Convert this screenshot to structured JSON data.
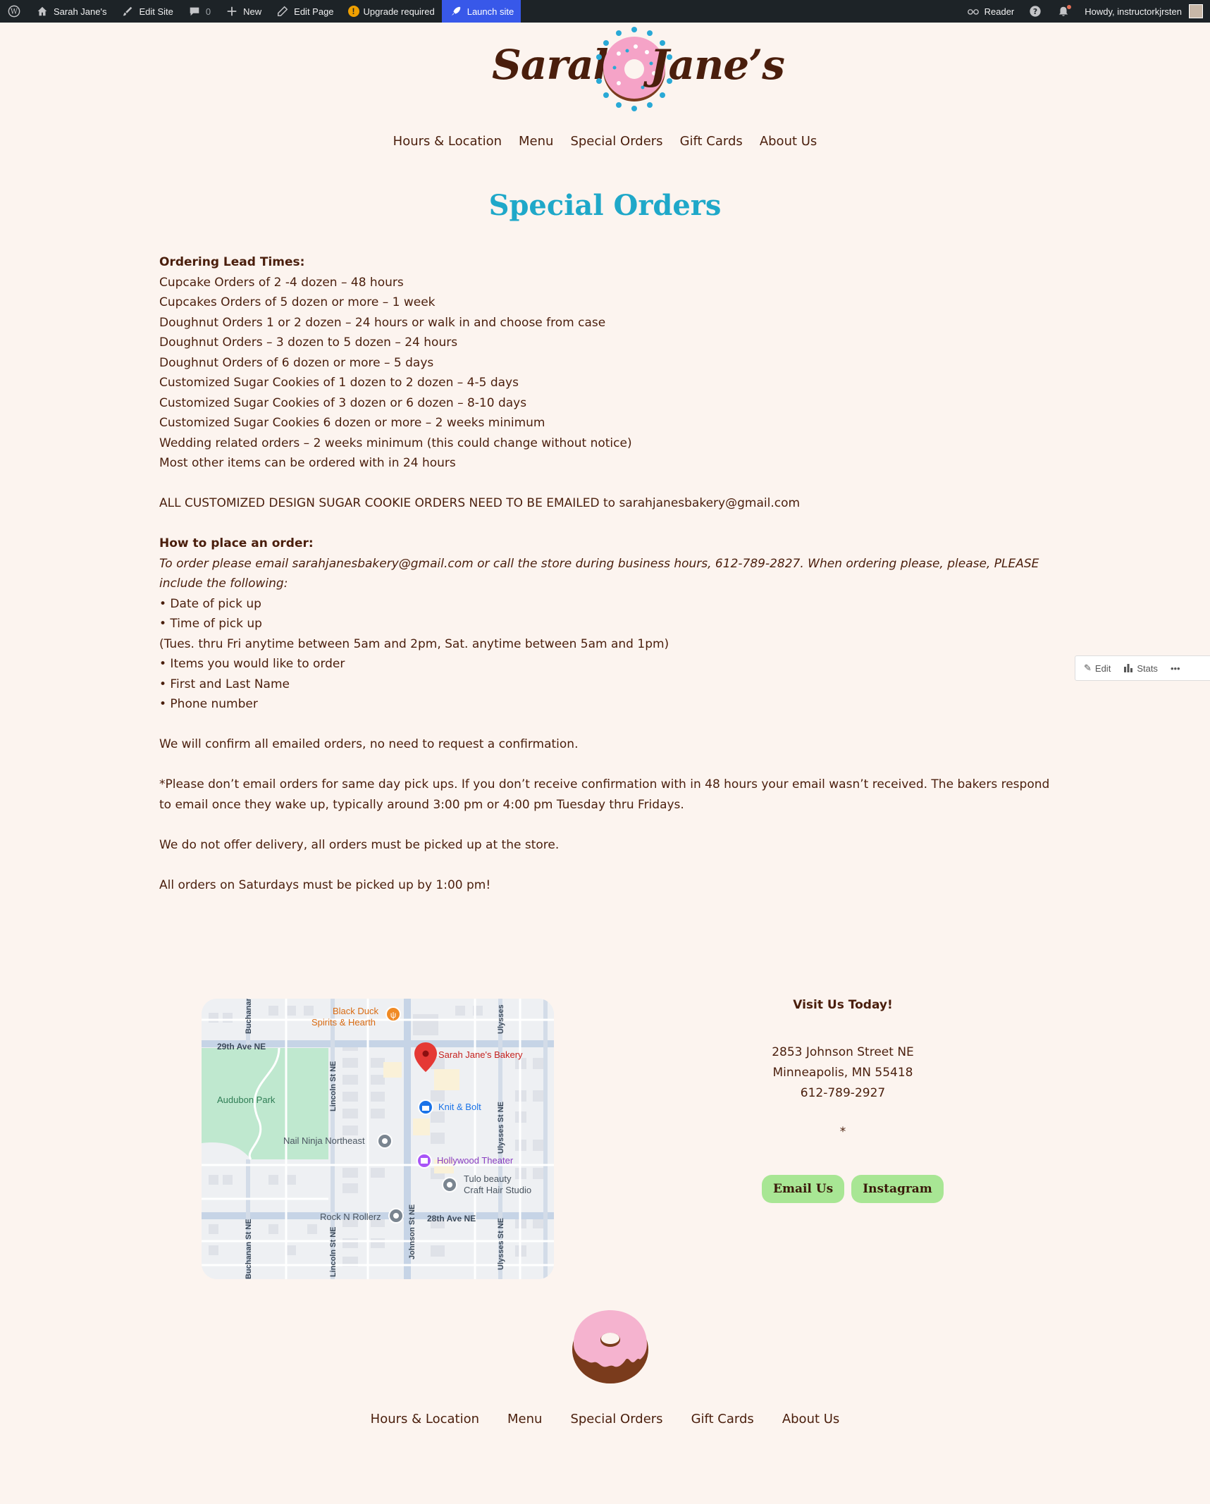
{
  "adminbar": {
    "site_name": "Sarah Jane's",
    "edit_site": "Edit Site",
    "comments_count": "0",
    "new_label": "New",
    "edit_page": "Edit Page",
    "upgrade": "Upgrade required",
    "launch": "Launch site",
    "reader": "Reader",
    "howdy": "Howdy, instructorkjrsten"
  },
  "header": {
    "logo_left": "Sarah",
    "logo_right": "Jane’s",
    "nav": [
      "Hours & Location",
      "Menu",
      "Special Orders",
      "Gift Cards",
      "About Us"
    ]
  },
  "page": {
    "title": "Special Orders",
    "lead_heading": "Ordering Lead Times:",
    "lead_times": [
      "Cupcake Orders of 2 -4 dozen – 48 hours",
      "Cupcakes Orders of 5 dozen or more – 1 week",
      "Doughnut Orders 1 or 2 dozen – 24 hours or walk in and choose from case",
      "Doughnut Orders – 3 dozen to 5 dozen – 24 hours",
      "Doughnut Orders of 6 dozen or more – 5 days",
      "Customized Sugar Cookies of 1 dozen to 2 dozen – 4-5 days",
      "Customized Sugar Cookies of 3 dozen or 6 dozen – 8-10 days",
      "Customized Sugar Cookies 6 dozen or more – 2 weeks minimum",
      "Wedding related orders – 2 weeks minimum (this could change without notice)",
      "Most other items can be ordered with in 24 hours"
    ],
    "custom_notice": "ALL CUSTOMIZED DESIGN SUGAR COOKIE ORDERS NEED TO BE EMAILED to sarahjanesbakery@gmail.com",
    "how_heading": "How to place an order:",
    "how_intro": "To order please email sarahjanesbakery@gmail.com or call the store during business hours, 612-789-2827. When ordering please, please, PLEASE include the following:",
    "bullet_1": "• Date of pick up",
    "bullet_2": "• Time of pick up",
    "hours_note": "(Tues. thru Fri anytime between 5am and 2pm, Sat. anytime between 5am and 1pm)",
    "bullet_3": "• Items you would like to order",
    "bullet_4": "• First and Last Name",
    "bullet_5": "• Phone number",
    "confirm": "We will confirm all emailed orders, no need to request a confirmation.",
    "same_day": "*Please don’t email orders for same day pick ups. If you don’t receive confirmation with in 48 hours your email wasn’t received. The bakers respond to email once they wake up, typically around 3:00 pm or 4:00 pm Tuesday thru Fridays.",
    "delivery": "We do not offer delivery, all orders must be picked up at the store.",
    "saturday": "All orders on Saturdays must be picked up by 1:00 pm!"
  },
  "floatbar": {
    "edit": "Edit",
    "stats": "Stats",
    "more": "•••"
  },
  "map": {
    "labels": {
      "black_duck_1": "Black Duck",
      "black_duck_2": "Spirits & Hearth",
      "ave29": "29th Ave NE",
      "bakery": "Sarah Jane's Bakery",
      "audubon": "Audubon Park",
      "knit": "Knit & Bolt",
      "nail": "Nail Ninja Northeast",
      "hollywood": "Hollywood Theater",
      "tulo_1": "Tulo beauty",
      "tulo_2": "Craft Hair Studio",
      "rock": "Rock N Rollerz",
      "ave28": "28th Ave NE",
      "lincoln": "Lincoln St NE",
      "johnson": "Johnson St NE",
      "ulysses": "Ulysses St NE",
      "ulysses_top": "Ulysses",
      "buchanan_top": "Buchanan",
      "buchanan_bottom": "Buchanan St NE"
    }
  },
  "visit": {
    "heading": "Visit Us Today!",
    "street": "2853 Johnson Street NE",
    "city": "Minneapolis, MN 55418",
    "phone": "612-789-2927",
    "asterisk": "*",
    "email_btn": "Email Us",
    "instagram_btn": "Instagram"
  },
  "footer": {
    "nav": [
      "Hours & Location",
      "Menu",
      "Special Orders",
      "Gift Cards",
      "About Us"
    ]
  },
  "colors": {
    "background": "#fcf4ef",
    "title": "#1fa8c9",
    "text": "#4a1e0c",
    "button": "#a8e694",
    "admin_bar": "#1d2327",
    "launch": "#3858e9"
  }
}
